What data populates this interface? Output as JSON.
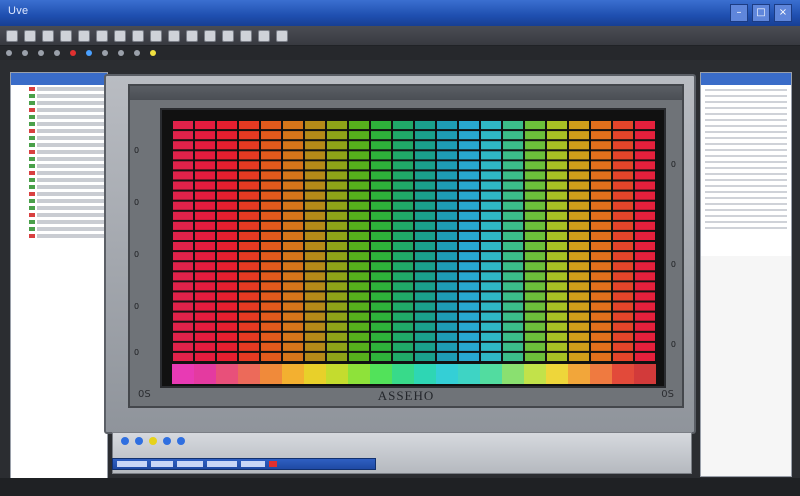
{
  "window": {
    "title": "Uve"
  },
  "toolbar": {
    "buttons": 16
  },
  "panel": {
    "header_label": "",
    "footer_label": "ASSEHO",
    "left_ticks": [
      "0",
      "0",
      "0",
      "0",
      "0"
    ],
    "right_ticks": [
      "0",
      "0",
      "0"
    ],
    "corner_left": "0S",
    "corner_right": "0S"
  },
  "chart_data": {
    "type": "heatmap",
    "title": "",
    "xlabel": "",
    "ylabel": "",
    "columns": 22,
    "rows": 24,
    "palette": [
      "#e0224a",
      "#e41c3e",
      "#e61f2f",
      "#e63a22",
      "#e25a1c",
      "#d6751a",
      "#b48a18",
      "#8ea318",
      "#56b01c",
      "#2eb13a",
      "#20a968",
      "#1aa08c",
      "#1e9cb4",
      "#28a8d0",
      "#2fb7c4",
      "#3bbd8a",
      "#6cbf3a",
      "#a8c024",
      "#d09e1a",
      "#e2701c",
      "#e4452a",
      "#e5203c"
    ],
    "base_palette": [
      "#e83ab4",
      "#e43aa0",
      "#e8507a",
      "#ec6a5a",
      "#f08a3a",
      "#f3b030",
      "#e8d02a",
      "#c4dc2e",
      "#8ee23a",
      "#52e25a",
      "#38da8a",
      "#2ed6b4",
      "#34cfd6",
      "#3ed4c4",
      "#52dca0",
      "#8ae070",
      "#c2e24a",
      "#eed63a",
      "#f2a63a",
      "#ef7a40",
      "#e24a3a",
      "#d23a3a"
    ]
  },
  "colors": {
    "titlebar": "#1f4fb0",
    "accent_red": "#e03030",
    "accent_blue": "#4aa0ff",
    "accent_yellow": "#f0e040"
  }
}
